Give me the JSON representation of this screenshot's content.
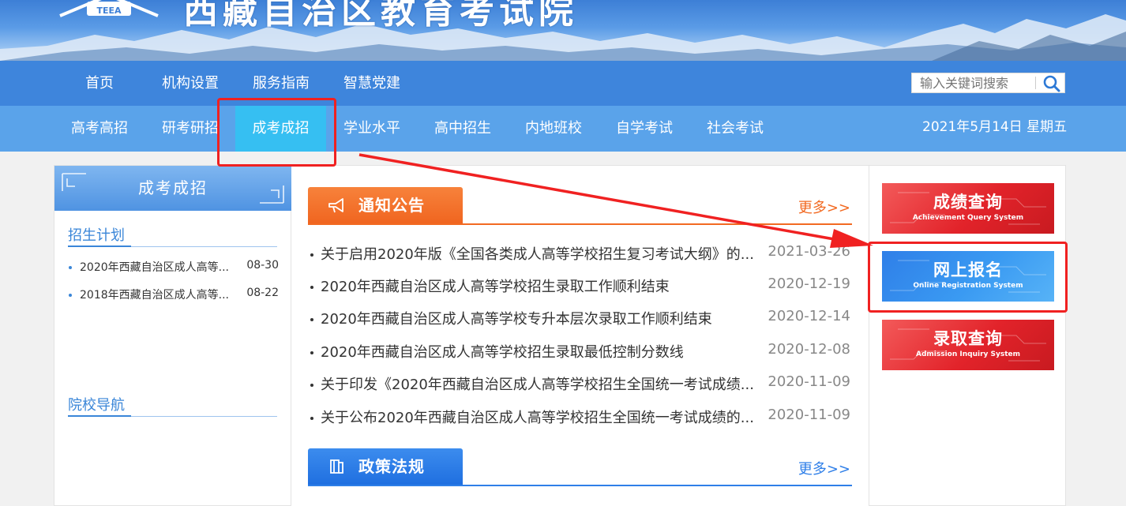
{
  "banner": {
    "site_title": "西藏自治区教育考试院",
    "logo_text": "TEEA"
  },
  "nav_primary": [
    {
      "label": "首页"
    },
    {
      "label": "机构设置"
    },
    {
      "label": "服务指南"
    },
    {
      "label": "智慧党建"
    }
  ],
  "search": {
    "placeholder": "输入关键词搜索"
  },
  "nav_secondary": [
    {
      "label": "高考高招"
    },
    {
      "label": "研考研招"
    },
    {
      "label": "成考成招",
      "active": true
    },
    {
      "label": "学业水平"
    },
    {
      "label": "高中招生"
    },
    {
      "label": "内地班校"
    },
    {
      "label": "自学考试"
    },
    {
      "label": "社会考试"
    }
  ],
  "date_text": "2021年5月14日 星期五",
  "sidebar": {
    "title": "成考成招",
    "section1_title": "招生计划",
    "section1_items": [
      {
        "title": "2020年西藏自治区成人高等...",
        "date": "08-30"
      },
      {
        "title": "2018年西藏自治区成人高等...",
        "date": "08-22"
      }
    ],
    "section2_title": "院校导航"
  },
  "notices": {
    "title": "通知公告",
    "more": "更多>>",
    "items": [
      {
        "title": "关于启用2020年版《全国各类成人高等学校招生复习考试大纲》的...",
        "date": "2021-03-26"
      },
      {
        "title": "2020年西藏自治区成人高等学校招生录取工作顺利结束",
        "date": "2020-12-19"
      },
      {
        "title": "2020年西藏自治区成人高等学校专升本层次录取工作顺利结束",
        "date": "2020-12-14"
      },
      {
        "title": "2020年西藏自治区成人高等学校招生录取最低控制分数线",
        "date": "2020-12-08"
      },
      {
        "title": "关于印发《2020年西藏自治区成人高等学校招生全国统一考试成绩...",
        "date": "2020-11-09"
      },
      {
        "title": "关于公布2020年西藏自治区成人高等学校招生全国统一考试成绩的...",
        "date": "2020-11-09"
      }
    ]
  },
  "policy": {
    "title": "政策法规",
    "more": "更多>>"
  },
  "quick_links": [
    {
      "cn": "成绩查询",
      "en": "Achievement Query System",
      "color": "red"
    },
    {
      "cn": "网上报名",
      "en": "Online Registration System",
      "color": "blue"
    },
    {
      "cn": "录取查询",
      "en": "Admission Inquiry System",
      "color": "red"
    }
  ],
  "colors": {
    "nav_primary_bg": "#3e85dc",
    "nav_secondary_bg": "#5aa3ea",
    "active_tab_bg": "#36bff2",
    "notice_orange": "#f26a22",
    "policy_blue": "#2f7fe8",
    "annotation_red": "#f02121"
  }
}
